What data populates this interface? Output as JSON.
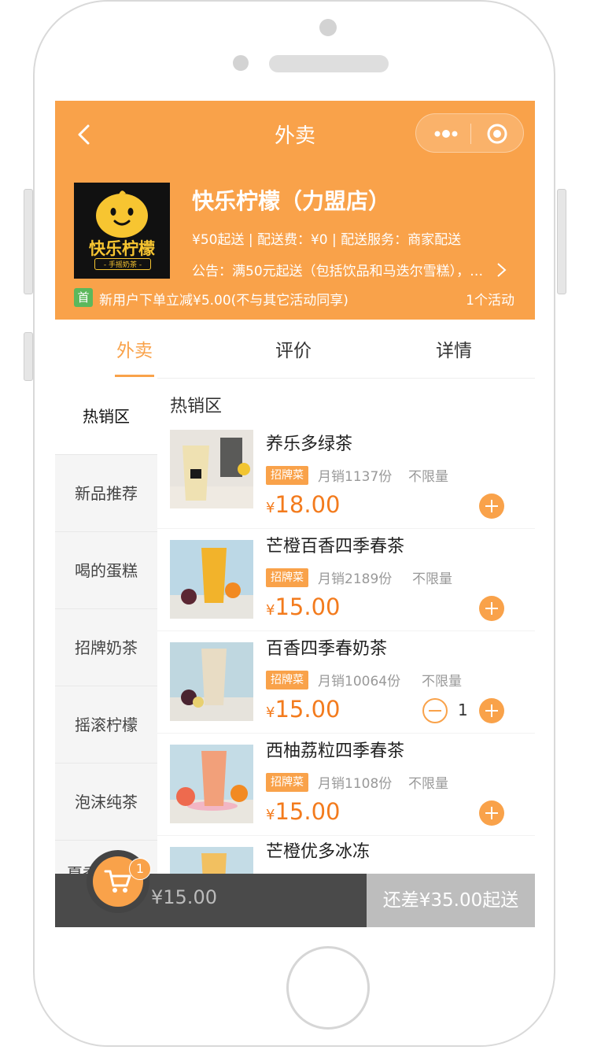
{
  "nav": {
    "title": "外卖"
  },
  "shop": {
    "logo_text": "快乐柠檬",
    "logo_sub": "- 手摇奶茶 -",
    "name": "快乐柠檬（力盟店）",
    "meta": "¥50起送 | 配送费：¥0 | 配送服务：商家配送",
    "notice": "公告：满50元起送（包括饮品和马迭尔雪糕），…"
  },
  "promo": {
    "badge": "首",
    "text": "新用户下单立减¥5.00(不与其它活动同享)",
    "count": "1个活动"
  },
  "tabs": [
    "外卖",
    "评价",
    "详情"
  ],
  "categories": [
    "热销区",
    "新品推荐",
    "喝的蛋糕",
    "招牌奶茶",
    "摇滚柠檬",
    "泡沫纯茶",
    "夏季限定系"
  ],
  "section_title": "热销区",
  "items": [
    {
      "name": "养乐多绿茶",
      "tag": "招牌菜",
      "sales": "月销1137份",
      "limit": "不限量",
      "currency": "¥",
      "price": "18.00"
    },
    {
      "name": "芒橙百香四季春茶",
      "tag": "招牌菜",
      "sales": "月销2189份",
      "limit": "不限量",
      "currency": "¥",
      "price": "15.00"
    },
    {
      "name": "百香四季春奶茶",
      "tag": "招牌菜",
      "sales": "月销10064份",
      "limit": "不限量",
      "currency": "¥",
      "price": "15.00",
      "qty": "1"
    },
    {
      "name": "西柚荔粒四季春茶",
      "tag": "招牌菜",
      "sales": "月销1108份",
      "limit": "不限量",
      "currency": "¥",
      "price": "15.00"
    },
    {
      "name": "芒橙优多冰冻"
    }
  ],
  "cart": {
    "badge": "1",
    "total": "¥15.00",
    "checkout": "还差¥35.00起送"
  },
  "colors": {
    "brand": "#f9a24a",
    "price": "#f37b1d"
  }
}
